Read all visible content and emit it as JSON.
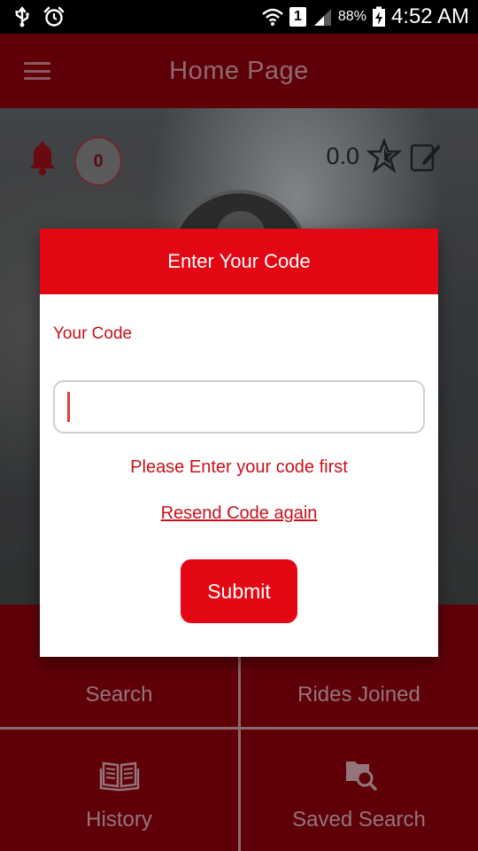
{
  "status_bar": {
    "battery_percent": "88%",
    "time": "4:52 AM",
    "sim_label": "1",
    "icons": [
      "usb-icon",
      "alarm-icon",
      "wifi-icon",
      "signal-icon",
      "battery-charging-icon"
    ]
  },
  "app_bar": {
    "title": "Home Page",
    "menu_icon": "hamburger-menu-icon"
  },
  "hero": {
    "notification_count": "0",
    "rating_value": "0.0",
    "icons": [
      "bell-icon",
      "star-icon",
      "edit-icon",
      "avatar"
    ]
  },
  "grid": {
    "tiles": [
      {
        "label": "Search",
        "icon": "search-icon"
      },
      {
        "label": "Rides Joined",
        "icon": "rides-icon"
      },
      {
        "label": "History",
        "icon": "history-icon"
      },
      {
        "label": "Saved Search",
        "icon": "saved-search-icon"
      }
    ]
  },
  "dialog": {
    "title": "Enter Your Code",
    "field_label": "Your Code",
    "input_value": "",
    "error_message": "Please Enter your code first",
    "resend_link": "Resend Code again",
    "submit_label": "Submit"
  },
  "colors": {
    "primary_red": "#e30613",
    "dark_red": "#5f0009",
    "text_red": "#c8101a"
  }
}
